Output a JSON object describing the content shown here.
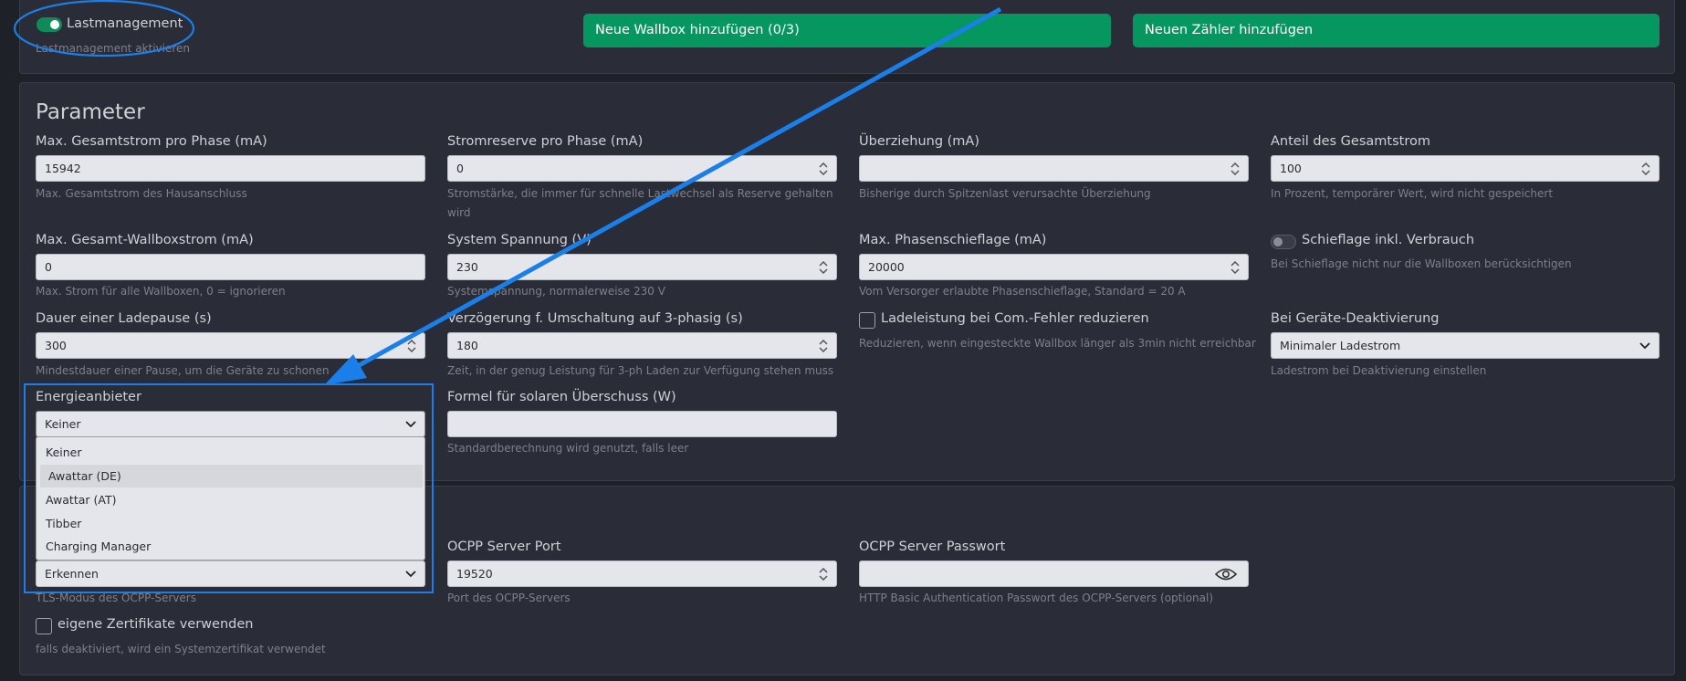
{
  "top": {
    "lastmanagement_label": "Lastmanagement",
    "lastmanagement_help": "Lastmanagement aktivieren",
    "add_wallbox_button": "Neue Wallbox hinzufügen (0/3)",
    "add_meter_button": "Neuen Zähler hinzufügen"
  },
  "parameter": {
    "title": "Parameter",
    "max_total_current": {
      "label": "Max. Gesamtstrom pro Phase (mA)",
      "value": "15942",
      "help": "Max. Gesamtstrom des Hausanschluss"
    },
    "current_reserve": {
      "label": "Stromreserve pro Phase (mA)",
      "value": "0",
      "help": "Stromstärke, die immer für schnelle Lastwechsel als Reserve gehalten wird"
    },
    "overdraw": {
      "label": "Überziehung (mA)",
      "value": "",
      "help": "Bisherige durch Spitzenlast verursachte Überziehung"
    },
    "total_share": {
      "label": "Anteil des Gesamtstrom",
      "value": "100",
      "help": "In Prozent, temporärer Wert, wird nicht gespeichert"
    },
    "max_wallbox_current": {
      "label": "Max. Gesamt-Wallboxstrom (mA)",
      "value": "0",
      "help": "Max. Strom für alle Wallboxen, 0 = ignorieren"
    },
    "system_voltage": {
      "label": "System Spannung (V)",
      "value": "230",
      "help": "Systemspannung, normalerweise 230 V"
    },
    "max_phase_imbalance": {
      "label": "Max. Phasenschieflage (mA)",
      "value": "20000",
      "help": "Vom Versorger erlaubte Phasenschieflage, Standard = 20 A"
    },
    "imbalance_incl": {
      "label": "Schieflage inkl. Verbrauch",
      "help": "Bei Schieflage nicht nur die Wallboxen berücksichtigen"
    },
    "pause_duration": {
      "label": "Dauer einer Ladepause (s)",
      "value": "300",
      "help": "Mindestdauer einer Pause, um die Geräte zu schonen"
    },
    "switch_delay": {
      "label": "Verzögerung f. Umschaltung auf 3-phasig (s)",
      "value": "180",
      "help": "Zeit, in der genug Leistung für 3-ph Laden zur Verfügung stehen muss"
    },
    "reduce_on_error": {
      "label": "Ladeleistung bei Com.-Fehler reduzieren",
      "help": "Reduzieren, wenn eingesteckte Wallbox länger als 3min nicht erreichbar"
    },
    "device_deactivation": {
      "label": "Bei Geräte-Deaktivierung",
      "value": "Minimaler Ladestrom",
      "help": "Ladestrom bei Deaktivierung einstellen"
    },
    "energy_provider": {
      "label": "Energieanbieter",
      "value": "Keiner",
      "options": [
        "Keiner",
        "Awattar (DE)",
        "Awattar (AT)",
        "Tibber",
        "Charging Manager"
      ]
    },
    "solar_formula": {
      "label": "Formel für solaren Überschuss (W)",
      "value": "",
      "help": "Standardberechnung wird genutzt, falls leer"
    }
  },
  "ocpp": {
    "tls_mode": {
      "value": "Erkennen",
      "help": "TLS-Modus des OCPP-Servers"
    },
    "port": {
      "label": "OCPP Server Port",
      "value": "19520",
      "help": "Port des OCPP-Servers"
    },
    "password": {
      "label": "OCPP Server Passwort",
      "value": "",
      "help": "HTTP Basic Authentication Passwort des OCPP-Servers (optional)"
    },
    "own_certs": {
      "label": "eigene Zertifikate verwenden",
      "help": "falls deaktiviert, wird ein Systemzertifikat verwendet"
    }
  },
  "icons": [
    "chevron-down-icon",
    "spinner-arrows-icon",
    "eye-icon",
    "annotation-arrow"
  ],
  "colors": {
    "accent_green": "#069760",
    "annotation_blue": "#1a7fe8"
  }
}
